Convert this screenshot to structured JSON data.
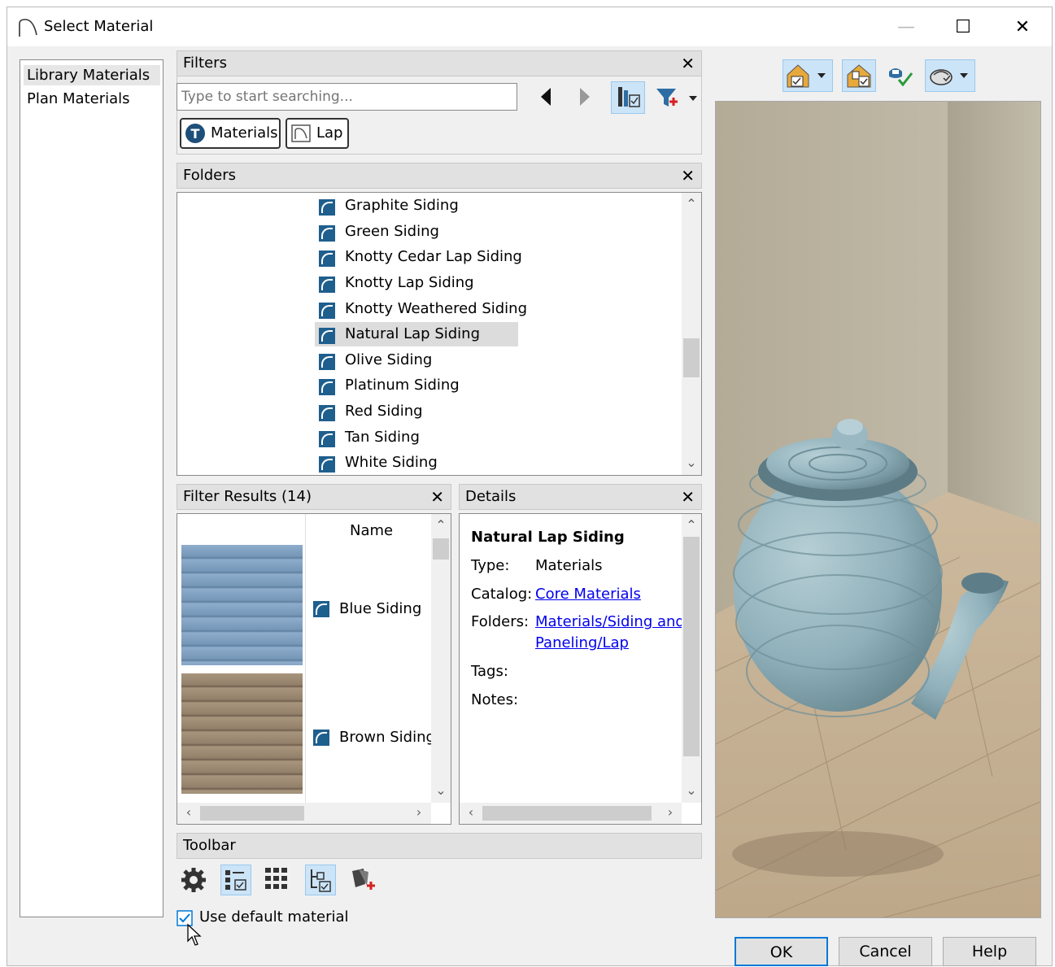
{
  "window": {
    "title": "Select Material",
    "minimize": "—",
    "maximize": "☐",
    "close": "✕"
  },
  "sidebar": {
    "items": [
      {
        "label": "Library Materials",
        "selected": true
      },
      {
        "label": "Plan Materials",
        "selected": false
      }
    ]
  },
  "filters": {
    "header": "Filters",
    "search_placeholder": "Type to start searching...",
    "chips": [
      {
        "label": "Materials",
        "icon": "materials-type-icon"
      },
      {
        "label": "Lap",
        "icon": "folder-icon"
      }
    ]
  },
  "folders": {
    "header": "Folders",
    "items": [
      {
        "label": "Graphite Siding"
      },
      {
        "label": "Green Siding"
      },
      {
        "label": "Knotty Cedar Lap Siding"
      },
      {
        "label": "Knotty Lap Siding"
      },
      {
        "label": "Knotty Weathered Siding"
      },
      {
        "label": "Natural Lap Siding",
        "selected": true
      },
      {
        "label": "Olive Siding"
      },
      {
        "label": "Platinum Siding"
      },
      {
        "label": "Red Siding"
      },
      {
        "label": "Tan Siding"
      },
      {
        "label": "White Siding"
      }
    ]
  },
  "results": {
    "header": "Filter Results (14)",
    "column_name": "Name",
    "items": [
      {
        "label": "Blue Siding",
        "swatch": "#7a9cbd"
      },
      {
        "label": "Brown Siding",
        "swatch": "#9a8770"
      }
    ]
  },
  "details": {
    "header": "Details",
    "name": "Natural Lap Siding",
    "type_label": "Type:",
    "type_value": "Materials",
    "catalog_label": "Catalog:",
    "catalog_value": "Core Materials",
    "folders_label": "Folders:",
    "folders_value_line1": "Materials/Siding and",
    "folders_value_line2": "Paneling/Lap",
    "tags_label": "Tags:",
    "notes_label": "Notes:"
  },
  "toolbar": {
    "header": "Toolbar"
  },
  "use_default": {
    "label": "Use default material",
    "checked": true
  },
  "buttons": {
    "ok": "OK",
    "cancel": "Cancel",
    "help": "Help"
  },
  "colors": {
    "accent": "#0078d7",
    "folder_icon": "#1e5f8e"
  }
}
